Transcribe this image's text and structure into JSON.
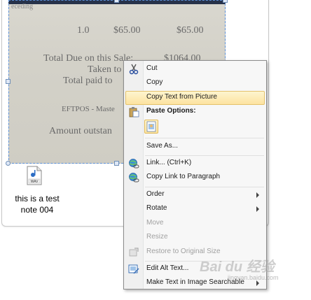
{
  "receipt": {
    "line_qty": "1.0",
    "line_price": "$65.00",
    "line_total": "$65.00",
    "due_label": "Total Due on this Sale:",
    "due_amount": "$1064.00",
    "taken_to": "Taken to",
    "total_paid": "Total paid to",
    "eftpos": "EFTPOS - Maste",
    "amount_outstanding": "Amount outstan",
    "top_word": "eceding"
  },
  "attachment": {
    "icon_label": "WAV",
    "name_line1": "this is a test",
    "name_line2": "note 004"
  },
  "context_menu": {
    "items": [
      {
        "label": "Cut",
        "icon": "scissors-icon"
      },
      {
        "label": "Copy",
        "icon": ""
      },
      {
        "label": "Copy Text from Picture",
        "icon": ""
      },
      {
        "label": "Paste Options:",
        "icon": "clipboard-icon"
      },
      {
        "label": "Save As...",
        "icon": ""
      },
      {
        "label": "Link...  (Ctrl+K)",
        "icon": "globe-link-icon"
      },
      {
        "label": "Copy Link to Paragraph",
        "icon": "globe-link-icon"
      },
      {
        "label": "Order",
        "icon": ""
      },
      {
        "label": "Rotate",
        "icon": ""
      },
      {
        "label": "Move",
        "icon": ""
      },
      {
        "label": "Resize",
        "icon": ""
      },
      {
        "label": "Restore to Original Size",
        "icon": "picture-restore-icon"
      },
      {
        "label": "Edit Alt Text...",
        "icon": "alt-text-icon"
      },
      {
        "label": "Make Text in Image Searchable",
        "icon": ""
      }
    ]
  },
  "watermark": {
    "text": "Bai du 经验",
    "sub": "jingyan.baidu.com"
  },
  "colors": {
    "menu_highlight": "#fde3a0",
    "selection_border": "#5b8fd6"
  }
}
